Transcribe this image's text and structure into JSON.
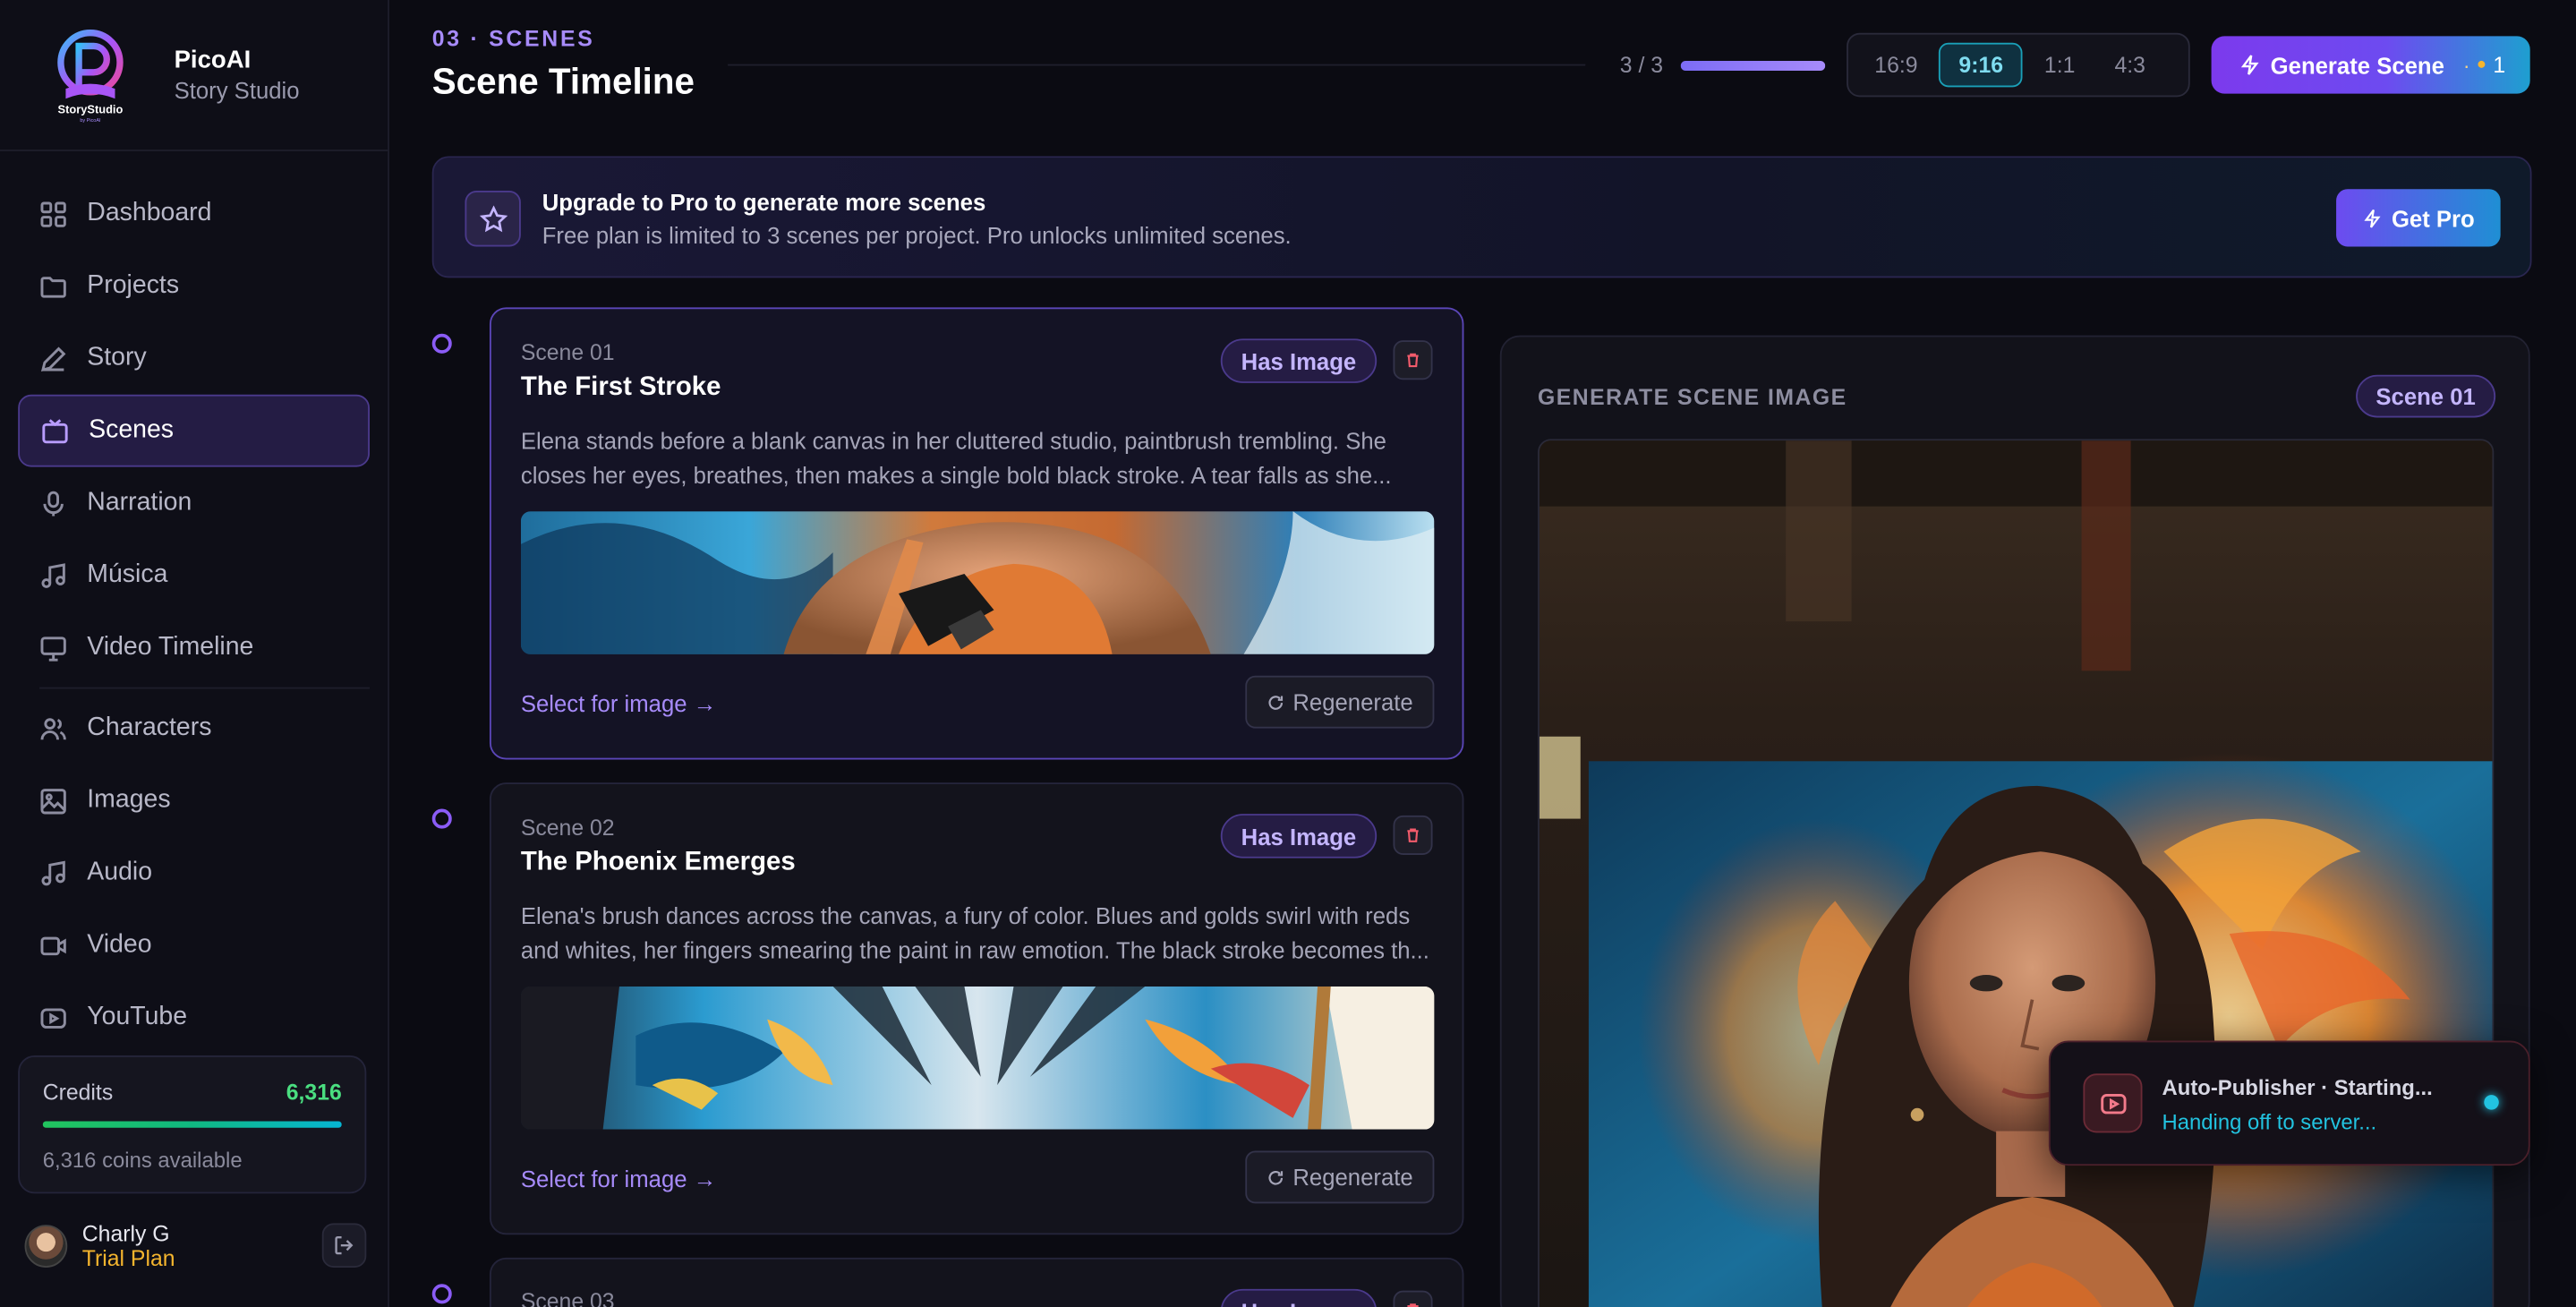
{
  "brand": {
    "logo_text": "StoryStudio",
    "name": "PicoAI",
    "subtitle": "Story Studio"
  },
  "sidebar": {
    "items": [
      {
        "label": "Dashboard",
        "icon": "grid-icon"
      },
      {
        "label": "Projects",
        "icon": "folder-icon"
      },
      {
        "label": "Story",
        "icon": "pen-icon"
      },
      {
        "label": "Scenes",
        "icon": "tv-icon",
        "active": true
      },
      {
        "label": "Narration",
        "icon": "mic-icon"
      },
      {
        "label": "Música",
        "icon": "music-icon"
      },
      {
        "label": "Video Timeline",
        "icon": "monitor-icon"
      },
      {
        "label": "Characters",
        "icon": "users-icon"
      },
      {
        "label": "Images",
        "icon": "image-icon"
      },
      {
        "label": "Audio",
        "icon": "music-icon"
      },
      {
        "label": "Video",
        "icon": "video-icon"
      },
      {
        "label": "YouTube",
        "icon": "youtube-icon"
      }
    ],
    "credits": {
      "label": "Credits",
      "value": "6,316",
      "sub": "6,316 coins available",
      "fill_fraction": 1.0
    },
    "user": {
      "name": "Charly G",
      "plan": "Trial Plan"
    }
  },
  "header": {
    "eyebrow": "03 · SCENES",
    "title": "Scene Timeline",
    "progress_text": "3 / 3",
    "progress_fraction": 1.0,
    "ratios": [
      "16:9",
      "9:16",
      "1:1",
      "4:3"
    ],
    "active_ratio": "9:16",
    "generate_label": "Generate Scene",
    "generate_cost_sep": "·",
    "generate_cost": "1"
  },
  "banner": {
    "title": "Upgrade to Pro to generate more scenes",
    "subtitle": "Free plan is limited to 3 scenes per project. Pro unlocks unlimited scenes.",
    "button": "Get Pro"
  },
  "scenes": [
    {
      "number": "Scene 01",
      "title": "The First Stroke",
      "badge": "Has Image",
      "description": "Elena stands before a blank canvas in her cluttered studio, paintbrush trembling. She closes her eyes, breathes, then makes a single bold black stroke. A tear falls as she...",
      "link": "Select for image →",
      "regen": "Regenerate"
    },
    {
      "number": "Scene 02",
      "title": "The Phoenix Emerges",
      "badge": "Has Image",
      "description": "Elena's brush dances across the canvas, a fury of color. Blues and golds swirl with reds and whites, her fingers smearing the paint in raw emotion. The black stroke becomes th...",
      "link": "Select for image →",
      "regen": "Regenerate"
    },
    {
      "number": "Scene 03",
      "title": "",
      "badge": "Has Image",
      "description": "",
      "link": "",
      "regen": ""
    }
  ],
  "panel": {
    "title": "GENERATE SCENE IMAGE",
    "badge": "Scene 01"
  },
  "toast": {
    "title": "Auto-Publisher · Starting...",
    "subtitle": "Handing off to server..."
  },
  "colors": {
    "accent": "#8b5cf6",
    "credits_green": "#4ade80",
    "plan_gold": "#f5b52e",
    "cyan": "#22c3e0"
  }
}
